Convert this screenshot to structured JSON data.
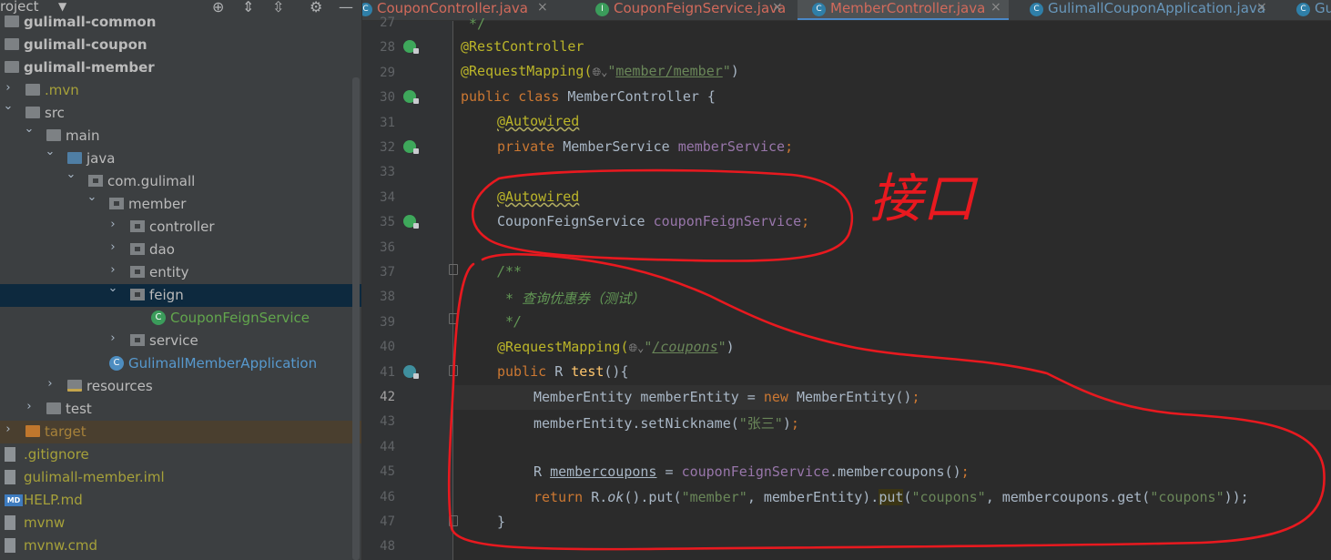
{
  "sidebar": {
    "header_title": "roject",
    "tree": [
      {
        "label": "gulimall-common",
        "color": "c-default",
        "bold": true,
        "indent": 0,
        "chevron": "",
        "icon": "folder mod"
      },
      {
        "label": "gulimall-coupon",
        "color": "c-default",
        "bold": true,
        "indent": 0,
        "chevron": "",
        "icon": "folder mod"
      },
      {
        "label": "gulimall-member",
        "color": "c-default",
        "bold": true,
        "indent": 0,
        "chevron": "",
        "icon": "folder mod"
      },
      {
        "label": ".mvn",
        "color": "c-olive",
        "bold": false,
        "indent": 0,
        "chevron": "right",
        "icon": "folder"
      },
      {
        "label": "src",
        "color": "c-default",
        "bold": false,
        "indent": 0,
        "chevron": "down",
        "icon": "folder"
      },
      {
        "label": "main",
        "color": "c-default",
        "bold": false,
        "indent": 1,
        "chevron": "down",
        "icon": "folder"
      },
      {
        "label": "java",
        "color": "c-default",
        "bold": false,
        "indent": 2,
        "chevron": "down",
        "icon": "folder src"
      },
      {
        "label": "com.gulimall",
        "color": "c-default",
        "bold": false,
        "indent": 3,
        "chevron": "down",
        "icon": "pkg"
      },
      {
        "label": "member",
        "color": "c-default",
        "bold": false,
        "indent": 4,
        "chevron": "down",
        "icon": "pkg"
      },
      {
        "label": "controller",
        "color": "c-default",
        "bold": false,
        "indent": 5,
        "chevron": "right",
        "icon": "pkg"
      },
      {
        "label": "dao",
        "color": "c-default",
        "bold": false,
        "indent": 5,
        "chevron": "right",
        "icon": "pkg"
      },
      {
        "label": "entity",
        "color": "c-default",
        "bold": false,
        "indent": 5,
        "chevron": "right",
        "icon": "pkg"
      },
      {
        "label": "feign",
        "color": "c-default",
        "bold": false,
        "indent": 5,
        "chevron": "down",
        "icon": "pkg",
        "selected": true
      },
      {
        "label": "CouponFeignService",
        "color": "c-green",
        "bold": false,
        "indent": 6,
        "chevron": "",
        "icon": "cls"
      },
      {
        "label": "service",
        "color": "c-default",
        "bold": false,
        "indent": 5,
        "chevron": "right",
        "icon": "pkg"
      },
      {
        "label": "GulimallMemberApplication",
        "color": "c-app",
        "bold": false,
        "indent": 4,
        "chevron": "",
        "icon": "cls app"
      },
      {
        "label": "resources",
        "color": "c-default",
        "bold": false,
        "indent": 2,
        "chevron": "right",
        "icon": "folder res"
      },
      {
        "label": "test",
        "color": "c-default",
        "bold": false,
        "indent": 1,
        "chevron": "right",
        "icon": "folder"
      },
      {
        "label": "target",
        "color": "c-target",
        "bold": false,
        "indent": 0,
        "chevron": "right",
        "icon": "folder target",
        "excluded": true
      },
      {
        "label": ".gitignore",
        "color": "c-olive",
        "bold": false,
        "indent": 0,
        "chevron": "",
        "icon": "file"
      },
      {
        "label": "gulimall-member.iml",
        "color": "c-olive",
        "bold": false,
        "indent": 0,
        "chevron": "",
        "icon": "file"
      },
      {
        "label": "HELP.md",
        "color": "c-olive",
        "bold": false,
        "indent": 0,
        "chevron": "",
        "icon": "mdfile"
      },
      {
        "label": "mvnw",
        "color": "c-olive",
        "bold": false,
        "indent": 0,
        "chevron": "",
        "icon": "file"
      },
      {
        "label": "mvnw.cmd",
        "color": "c-olive",
        "bold": false,
        "indent": 0,
        "chevron": "",
        "icon": "file"
      }
    ]
  },
  "tabs": [
    {
      "label": "CouponController.java",
      "color": "#d26a5b",
      "icon_color": "#2f7fa8",
      "active": false
    },
    {
      "label": "CouponFeignService.java",
      "color": "#d26a5b",
      "icon_color": "#3b9c5b",
      "active": false
    },
    {
      "label": "MemberController.java",
      "color": "#d26a5b",
      "icon_color": "#2f7fa8",
      "active": true
    },
    {
      "label": "GulimallCouponApplication.java",
      "color": "#6897bb",
      "icon_color": "#2f7fa8",
      "active": false
    },
    {
      "label": "Gul",
      "color": "#6897bb",
      "icon_color": "#2f7fa8",
      "active": false
    }
  ],
  "editor": {
    "line_numbers": [
      "27",
      "28",
      "29",
      "30",
      "31",
      "32",
      "33",
      "34",
      "35",
      "36",
      "37",
      "38",
      "39",
      "40",
      "41",
      "42",
      "43",
      "44",
      "45",
      "46",
      "47",
      "48"
    ],
    "current_line": "42",
    "code": {
      "l28": "@RestController",
      "l29_ann": "@RequestMapping(",
      "l29_str": "member/member",
      "l30_kw1": "public ",
      "l30_kw2": "class ",
      "l30_rest": "MemberController {",
      "l31": "@Autowired",
      "l32_kw": "private ",
      "l32_type": "MemberService ",
      "l32_field": "memberService",
      "l34": "@Autowired",
      "l35_type": "CouponFeignService ",
      "l35_field": "couponFeignService",
      "l37": "/**",
      "l38": " * 查询优惠券（测试）",
      "l39": " */",
      "l40_ann": "@RequestMapping(",
      "l40_str": "/coupons",
      "l41_kw": "public ",
      "l41_type": "R ",
      "l41_fn": "test",
      "l41_rest": "(){",
      "l42_a": "MemberEntity memberEntity = ",
      "l42_kw": "new ",
      "l42_b": "MemberEntity()",
      "l43_a": "memberEntity.setNickname(",
      "l43_str": "\"张三\"",
      "l45_a": "R ",
      "l45_var": "membercoupons",
      "l45_b": " = ",
      "l45_field": "couponFeignService",
      "l45_c": ".membercoupons()",
      "l46_kw": "return ",
      "l46_a": "R.",
      "l46_ok": "ok",
      "l46_b": "().put(",
      "l46_s1": "\"member\"",
      "l46_c": ", memberEntity).",
      "l46_put": "put",
      "l46_d": "(",
      "l46_s2": "\"coupons\"",
      "l46_e": ", membercoupons.get(",
      "l46_s3": "\"coupons\"",
      "l46_f": "));",
      "l47": "}"
    }
  },
  "annotation_text": "接口",
  "colors": {
    "handwriting": "#e8191f",
    "editor_bg": "#2b2b2b",
    "sidebar_bg": "#3c3f41",
    "selection": "#0d293e"
  }
}
